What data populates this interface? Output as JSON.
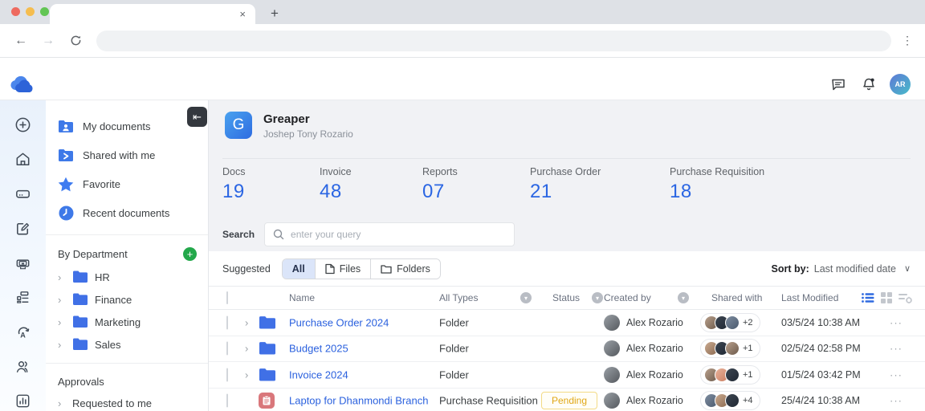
{
  "glyphs": {
    "close": "×",
    "plus": "+",
    "menu_v": "⋮",
    "back": "←",
    "forward": "→",
    "collapse": "⇤",
    "chevron_right": "›",
    "sort_down": "∨",
    "circle_down": "▾",
    "row_menu": "···",
    "add": "+"
  },
  "appbar": {
    "avatar_initials": "AR"
  },
  "nav": {
    "primary": [
      {
        "label": "My documents"
      },
      {
        "label": "Shared with me"
      },
      {
        "label": "Favorite"
      },
      {
        "label": "Recent documents"
      }
    ],
    "department": {
      "title": "By Department",
      "items": [
        {
          "label": "HR"
        },
        {
          "label": "Finance"
        },
        {
          "label": "Marketing"
        },
        {
          "label": "Sales"
        }
      ]
    },
    "approvals": {
      "title": "Approvals",
      "partial_item": "Requested to me"
    }
  },
  "profile": {
    "initial": "G",
    "name": "Greaper",
    "owner": "Joshep Tony Rozario"
  },
  "stats": [
    {
      "label": "Docs",
      "value": "19"
    },
    {
      "label": "Invoice",
      "value": "48"
    },
    {
      "label": "Reports",
      "value": "07"
    },
    {
      "label": "Purchase Order",
      "value": "21"
    },
    {
      "label": "Purchase Requisition",
      "value": "18"
    }
  ],
  "search": {
    "label": "Search",
    "placeholder": "enter your query"
  },
  "filters": {
    "suggested": "Suggested",
    "tabs": [
      {
        "label": "All"
      },
      {
        "label": "Files"
      },
      {
        "label": "Folders"
      }
    ],
    "active_tab": "All"
  },
  "sort": {
    "label": "Sort by:",
    "value": "Last modified date"
  },
  "table": {
    "headers": {
      "name": "Name",
      "type": "All Types",
      "status": "Status",
      "created_by": "Created by",
      "shared_with": "Shared with",
      "last_modified": "Last Modified"
    },
    "rows": [
      {
        "name": "Purchase Order 2024",
        "type": "Folder",
        "status": "",
        "created_by": "Alex Rozario",
        "shared_overflow": "+2",
        "last_modified": "03/5/24 10:38 AM"
      },
      {
        "name": "Budget 2025",
        "type": "Folder",
        "status": "",
        "created_by": "Alex Rozario",
        "shared_overflow": "+1",
        "last_modified": "02/5/24 02:58 PM"
      },
      {
        "name": "Invoice 2024",
        "type": "Folder",
        "status": "",
        "created_by": "Alex Rozario",
        "shared_overflow": "+1",
        "last_modified": "01/5/24 03:42 PM"
      },
      {
        "name": "Laptop for Dhanmondi Branch",
        "type": "Purchase Requisition",
        "status": "Pending",
        "created_by": "Alex Rozario",
        "shared_overflow": "+4",
        "last_modified": "25/4/24 10:38 AM"
      }
    ]
  },
  "colors": {
    "accent_blue": "#2b66e3",
    "folder_blue": "#4070e6",
    "pending_text": "#e0a716",
    "pending_border": "#f3da85",
    "requisition_red": "#d9777b",
    "green_add": "#23a84b"
  }
}
